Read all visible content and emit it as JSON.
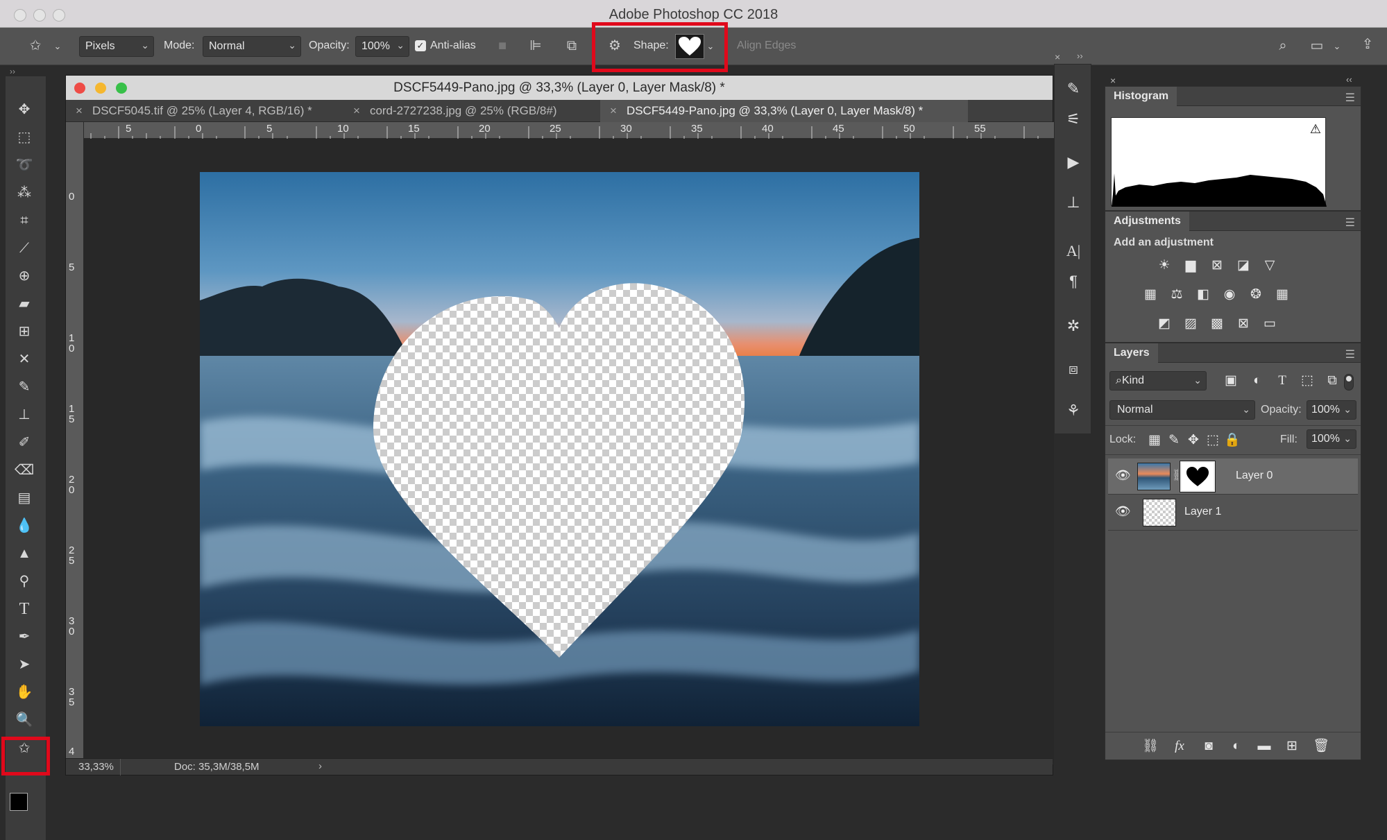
{
  "app": {
    "title": "Adobe Photoshop CC 2018"
  },
  "options": {
    "pixels": "Pixels",
    "mode_label": "Mode:",
    "mode_value": "Normal",
    "opacity_label": "Opacity:",
    "opacity_value": "100%",
    "antialias_label": "Anti-alias",
    "shape_label": "Shape:",
    "align_edges": "Align Edges"
  },
  "document": {
    "title": "DSCF5449-Pano.jpg @ 33,3% (Layer 0, Layer Mask/8) *",
    "tabs": [
      {
        "label": "DSCF5045.tif @ 25% (Layer 4, RGB/16) *"
      },
      {
        "label": "cord-2727238.jpg @ 25% (RGB/8#)"
      },
      {
        "label": "DSCF5449-Pano.jpg @ 33,3% (Layer 0, Layer Mask/8) *"
      }
    ],
    "zoom": "33,33%",
    "doc_size": "Doc: 35,3M/38,5M",
    "ruler_h": [
      "5",
      "0",
      "5",
      "10",
      "15",
      "20",
      "25",
      "30",
      "35",
      "40",
      "45",
      "50",
      "55"
    ],
    "ruler_v": [
      "0",
      "5",
      "10",
      "15",
      "20",
      "25",
      "30",
      "35",
      "4"
    ]
  },
  "panels": {
    "histogram": {
      "title": "Histogram"
    },
    "adjustments": {
      "title": "Adjustments",
      "subtitle": "Add an adjustment"
    },
    "layers": {
      "title": "Layers",
      "kind": "Kind",
      "blend_mode": "Normal",
      "opacity_label": "Opacity:",
      "opacity_value": "100%",
      "lock_label": "Lock:",
      "fill_label": "Fill:",
      "fill_value": "100%",
      "items": [
        {
          "name": "Layer 0"
        },
        {
          "name": "Layer 1"
        }
      ]
    }
  },
  "colors": {
    "highlight": "#e0091b",
    "panel_bg": "#535353",
    "canvas_bg": "#282828"
  }
}
